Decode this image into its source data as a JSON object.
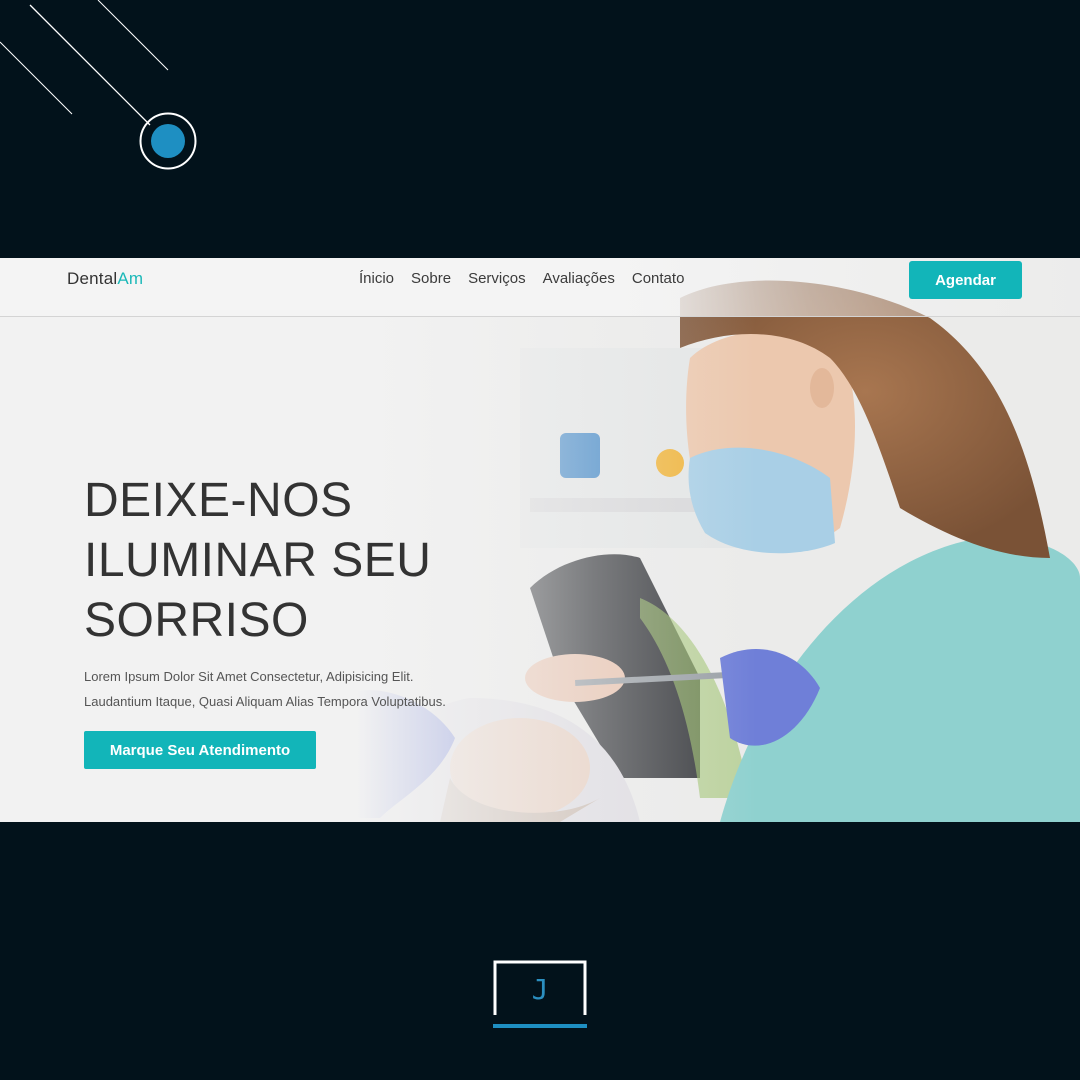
{
  "brand": {
    "name_main": "Dental",
    "name_accent": "Am",
    "accent_color": "#1bb8b8",
    "button_color": "#12b5b9",
    "background_color": "#02121b"
  },
  "nav": {
    "links": [
      "Ínicio",
      "Sobre",
      "Serviços",
      "Avaliações",
      "Contato"
    ],
    "cta_label": "Agendar"
  },
  "hero": {
    "title": "DEIXE-NOS\nILUMINAR SEU\nSORRISO",
    "description": "Lorem Ipsum Dolor Sit Amet Consectetur, Adipisicing Elit.\nLaudantium Itaque, Quasi Aliquam Alias Tempora Voluptatibus.",
    "button_label": "Marque Seu Atendimento",
    "image_subject": "dentist-treating-patient-photo"
  },
  "footer_mark": {
    "letter": "J"
  },
  "icons": [
    "decorative-lines-circle-icon",
    "j-logo-mark-icon"
  ]
}
